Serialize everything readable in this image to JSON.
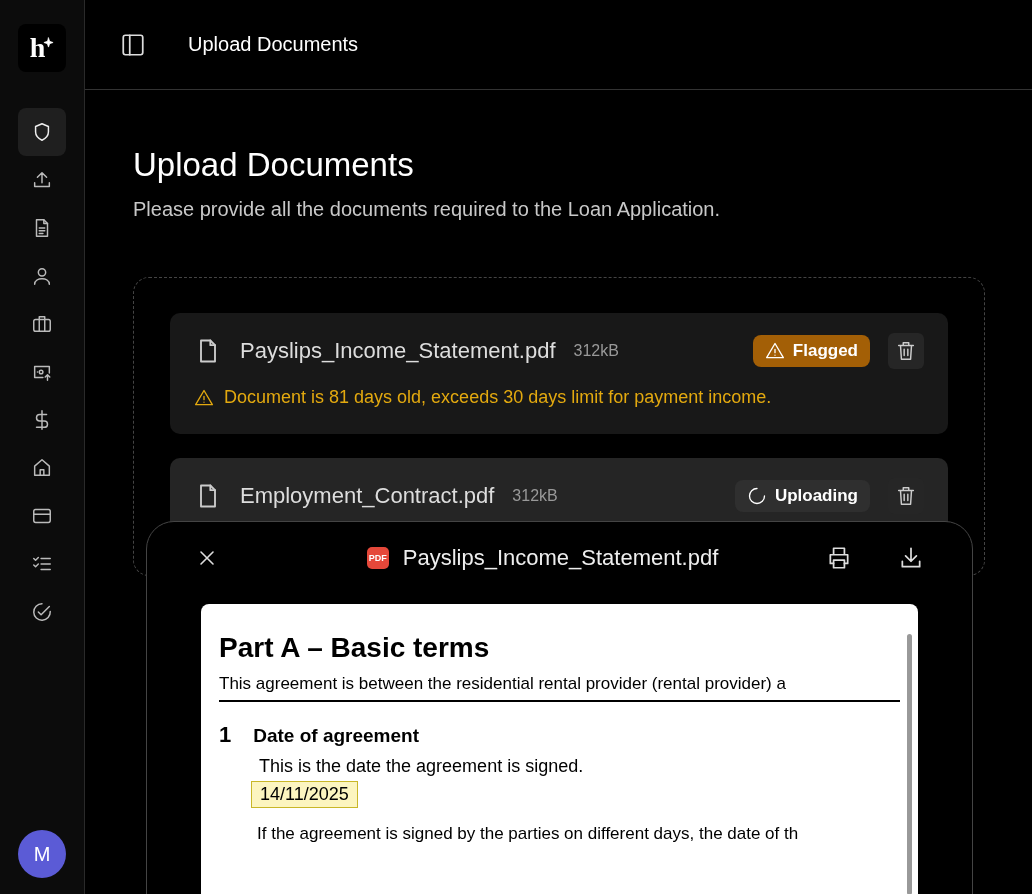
{
  "sidebar": {
    "logo": "h",
    "items": [
      {
        "kind": "shield",
        "selected": true
      },
      {
        "kind": "upload",
        "selected": false
      },
      {
        "kind": "document",
        "selected": false
      },
      {
        "kind": "user",
        "selected": false
      },
      {
        "kind": "briefcase",
        "selected": false
      },
      {
        "kind": "cash",
        "selected": false
      },
      {
        "kind": "dollar",
        "selected": false
      },
      {
        "kind": "home",
        "selected": false
      },
      {
        "kind": "card",
        "selected": false
      },
      {
        "kind": "checklist",
        "selected": false
      },
      {
        "kind": "check",
        "selected": false
      }
    ],
    "avatar": "M"
  },
  "header": {
    "title": "Upload Documents"
  },
  "page": {
    "title": "Upload Documents",
    "subtitle": "Please provide all the documents required to the Loan Application."
  },
  "files": [
    {
      "name": "Payslips_Income_Statement.pdf",
      "size": "312kB",
      "kind": "flagged",
      "status_label": "Flagged",
      "warning": "Document is 81 days old, exceeds 30 days limit for payment income."
    },
    {
      "name": "Employment_Contract.pdf",
      "size": "312kB",
      "kind": "uploading",
      "status_label": "Uploading"
    }
  ],
  "viewer": {
    "badge": "PDF",
    "filename": "Payslips_Income_Statement.pdf",
    "document": {
      "heading": "Part A – Basic terms",
      "intro": "This agreement is between the residential rental provider (rental provider) a",
      "section_number": "1",
      "section_title": "Date of agreement",
      "section_text": "This is the date the agreement is signed.",
      "date_value": "14/11/2025",
      "paragraph": "If the agreement is signed by the parties on different days, the date of th"
    }
  }
}
